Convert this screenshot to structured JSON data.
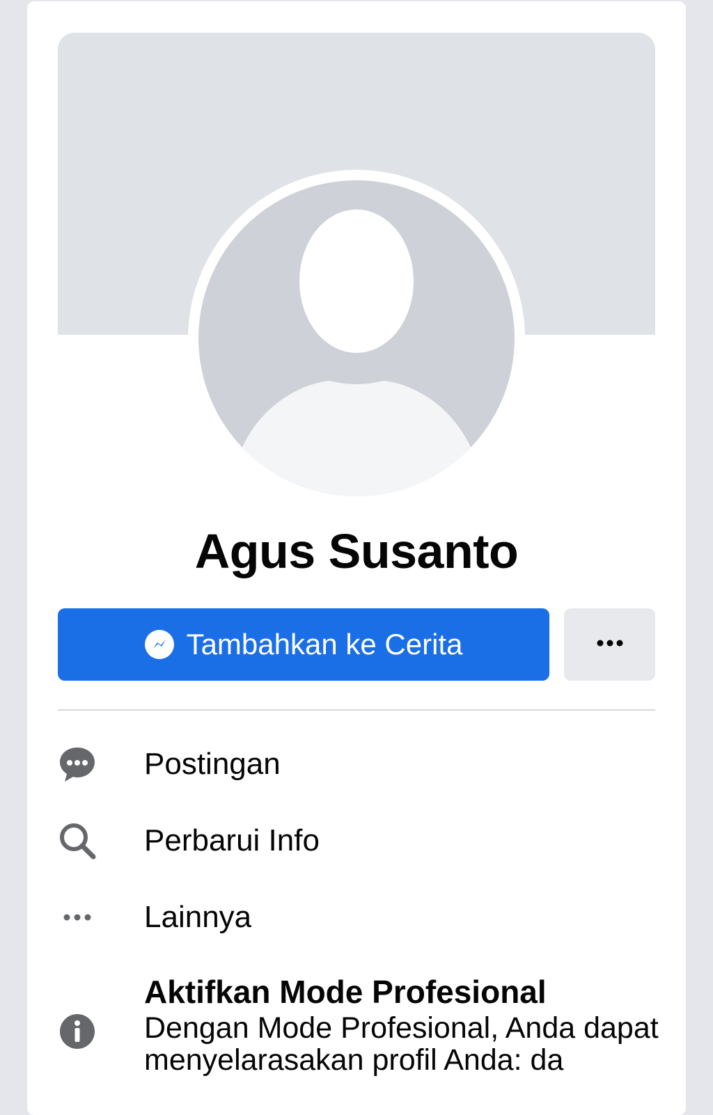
{
  "profile": {
    "name": "Agus Susanto"
  },
  "actions": {
    "primary_label": "Tambahkan ke Cerita",
    "primary_icon": "messenger-add-icon",
    "more_icon": "ellipsis-icon"
  },
  "menu": {
    "items": [
      {
        "label": "Postingan",
        "icon": "chat-bubble-icon"
      },
      {
        "label": "Perbarui Info",
        "icon": "search-icon"
      },
      {
        "label": "Lainnya",
        "icon": "ellipsis-icon"
      }
    ]
  },
  "professional": {
    "title": "Aktifkan Mode Profesional",
    "description": "Dengan Mode Profesional, Anda dapat menyelarasakan profil Anda: da",
    "icon": "info-icon"
  },
  "colors": {
    "accent": "#1b6fe6",
    "cover": "#dfe2e6",
    "avatar_bg": "#ced2d8",
    "icon_gray": "#65676b"
  }
}
